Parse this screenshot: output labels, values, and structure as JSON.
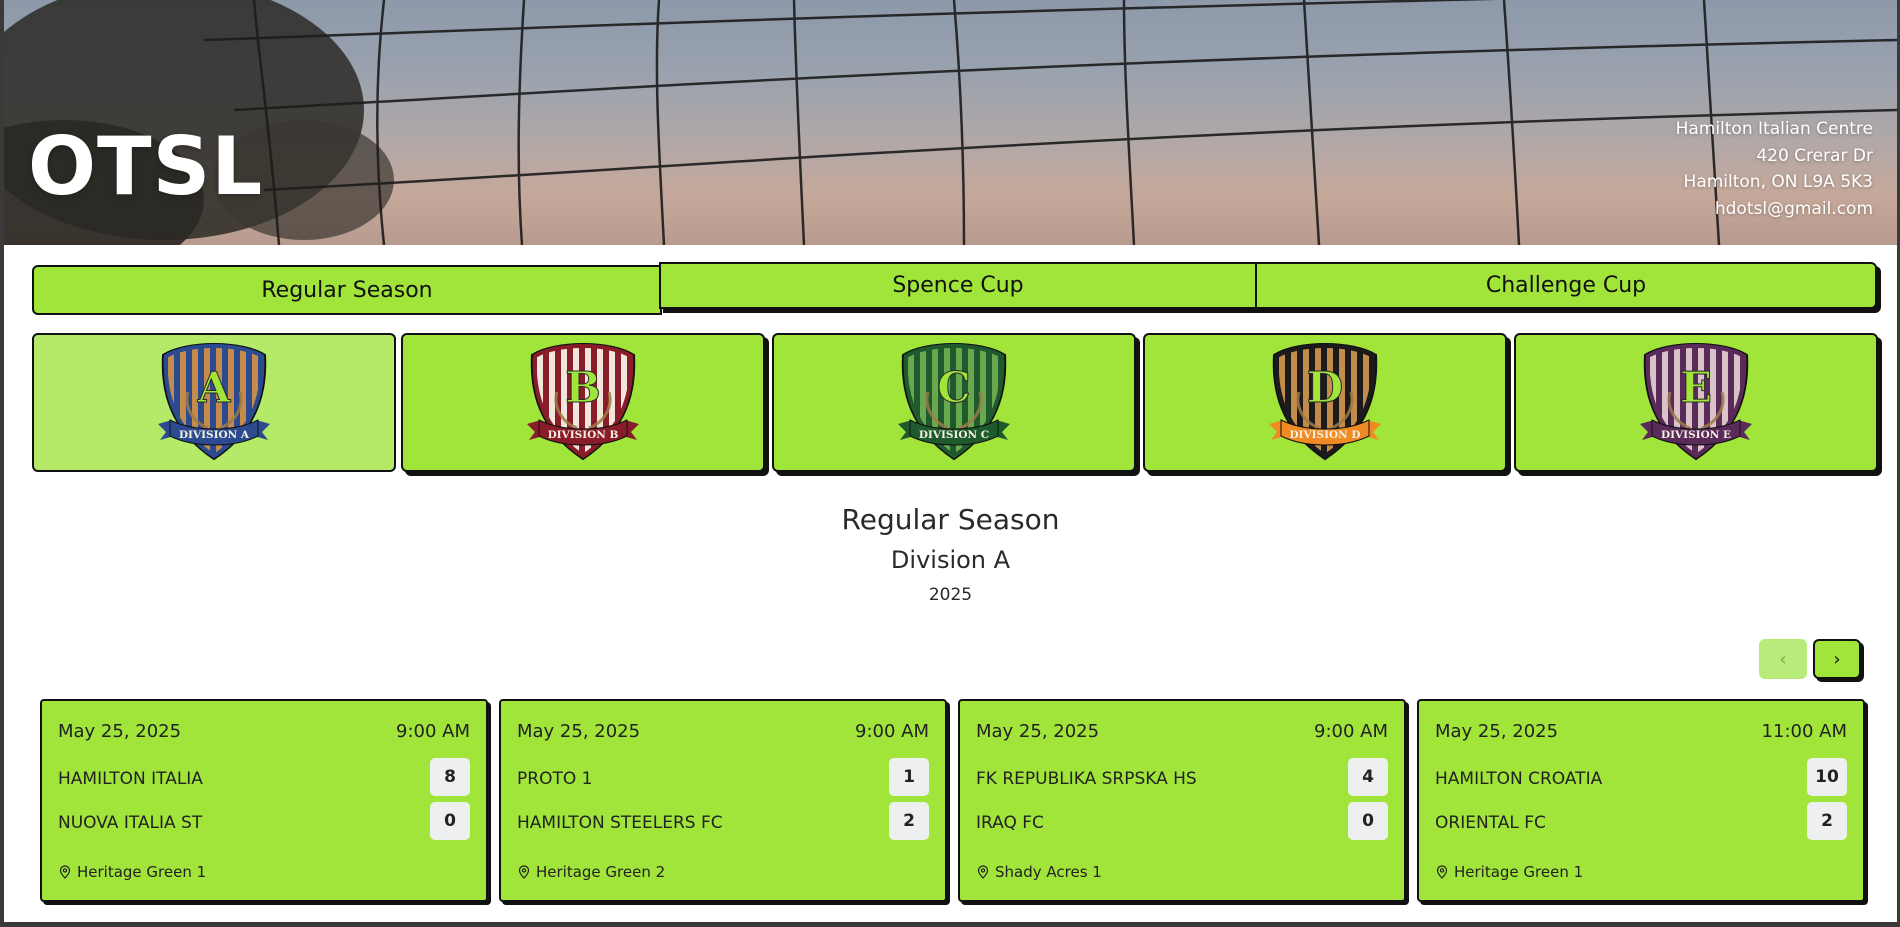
{
  "hero": {
    "brand": "OTSL",
    "contact": [
      "Hamilton Italian Centre",
      "420 Crerar Dr",
      "Hamilton, ON L9A 5K3",
      "hdotsl@gmail.com"
    ]
  },
  "tabs": [
    "Regular Season",
    "Spence Cup",
    "Challenge Cup"
  ],
  "divisions": [
    {
      "letter": "A",
      "label": "DIVISION A",
      "primary": "#2b4a8f",
      "stripe": "#c48c4a",
      "ribbon": "#2b4a8f",
      "letterColor": "#a1e43a"
    },
    {
      "letter": "B",
      "label": "DIVISION B",
      "primary": "#8a1c2a",
      "stripe": "#f1e6dc",
      "ribbon": "#8a1c2a",
      "letterColor": "#a1e43a"
    },
    {
      "letter": "C",
      "label": "DIVISION C",
      "primary": "#1f5a2c",
      "stripe": "#6aa84f",
      "ribbon": "#1f5a2c",
      "letterColor": "#a1e43a"
    },
    {
      "letter": "D",
      "label": "DIVISION D",
      "primary": "#1b1b1b",
      "stripe": "#c48c4a",
      "ribbon": "#f08a24",
      "letterColor": "#a1e43a"
    },
    {
      "letter": "E",
      "label": "DIVISION E",
      "primary": "#5a2a5a",
      "stripe": "#d9c2c8",
      "ribbon": "#5a2a5a",
      "letterColor": "#a1e43a"
    }
  ],
  "section": {
    "title": "Regular Season",
    "subtitle": "Division A",
    "year": "2025"
  },
  "pager": {
    "prev": "‹",
    "next": "›"
  },
  "matches": [
    {
      "date": "May 25, 2025",
      "time": "9:00 AM",
      "home": "HAMILTON ITALIA",
      "home_score": "8",
      "away": "NUOVA ITALIA ST",
      "away_score": "0",
      "location": "Heritage Green 1"
    },
    {
      "date": "May 25, 2025",
      "time": "9:00 AM",
      "home": "PROTO 1",
      "home_score": "1",
      "away": "HAMILTON STEELERS FC",
      "away_score": "2",
      "location": "Heritage Green 2"
    },
    {
      "date": "May 25, 2025",
      "time": "9:00 AM",
      "home": "FK REPUBLIKA SRPSKA HS",
      "home_score": "4",
      "away": "IRAQ FC",
      "away_score": "0",
      "location": "Shady Acres 1"
    },
    {
      "date": "May 25, 2025",
      "time": "11:00 AM",
      "home": "HAMILTON CROATIA",
      "home_score": "10",
      "away": "ORIENTAL FC",
      "away_score": "2",
      "location": "Heritage Green 1"
    }
  ]
}
